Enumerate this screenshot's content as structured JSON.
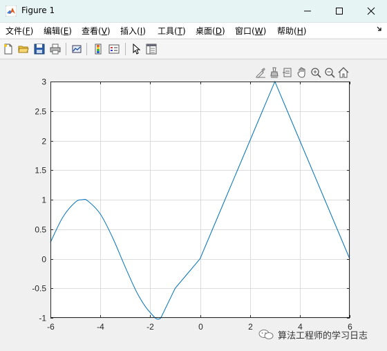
{
  "window": {
    "title": "Figure 1"
  },
  "menu": [
    {
      "label": "文件(",
      "key": "F",
      "tail": ")"
    },
    {
      "label": "编辑(",
      "key": "E",
      "tail": ")"
    },
    {
      "label": "查看(",
      "key": "V",
      "tail": ")"
    },
    {
      "label": "插入(",
      "key": "I",
      "tail": ")"
    },
    {
      "label": "工具(",
      "key": "T",
      "tail": ")"
    },
    {
      "label": "桌面(",
      "key": "D",
      "tail": ")"
    },
    {
      "label": "窗口(",
      "key": "W",
      "tail": ")"
    },
    {
      "label": "帮助(",
      "key": "H",
      "tail": ")"
    }
  ],
  "watermark": {
    "text": "算法工程师的学习日志"
  },
  "colors": {
    "line": "#0072bd",
    "grid": "#dcdcdc",
    "axis": "#262626"
  },
  "chart_data": {
    "type": "line",
    "title": "",
    "xlabel": "",
    "ylabel": "",
    "xlim": [
      -6,
      6
    ],
    "ylim": [
      -1,
      3
    ],
    "xticks": [
      "-6",
      "-4",
      "-2",
      "0",
      "2",
      "4",
      "6"
    ],
    "yticks": [
      "-1",
      "-0.5",
      "0",
      "0.5",
      "1",
      "1.5",
      "2",
      "2.5",
      "3"
    ],
    "grid": true,
    "series": [
      {
        "x": [
          -6,
          -5.5,
          -5,
          -4.712,
          -4.5,
          -4,
          -3.5,
          -3,
          -2.5,
          -2,
          -1.571,
          -1,
          -0.5,
          0,
          0.5,
          1,
          1.5,
          2,
          2.5,
          3,
          3.5,
          4,
          4.5,
          5,
          5.5,
          6
        ],
        "y": [
          0.279,
          0.706,
          0.959,
          1.0,
          0.978,
          0.757,
          0.351,
          -0.141,
          -0.598,
          -0.909,
          -1.0,
          -0.5,
          -0.25,
          0,
          0.5,
          1.0,
          1.5,
          2.0,
          2.5,
          3.0,
          2.5,
          2.0,
          1.5,
          1.0,
          0.5,
          0
        ]
      }
    ]
  }
}
